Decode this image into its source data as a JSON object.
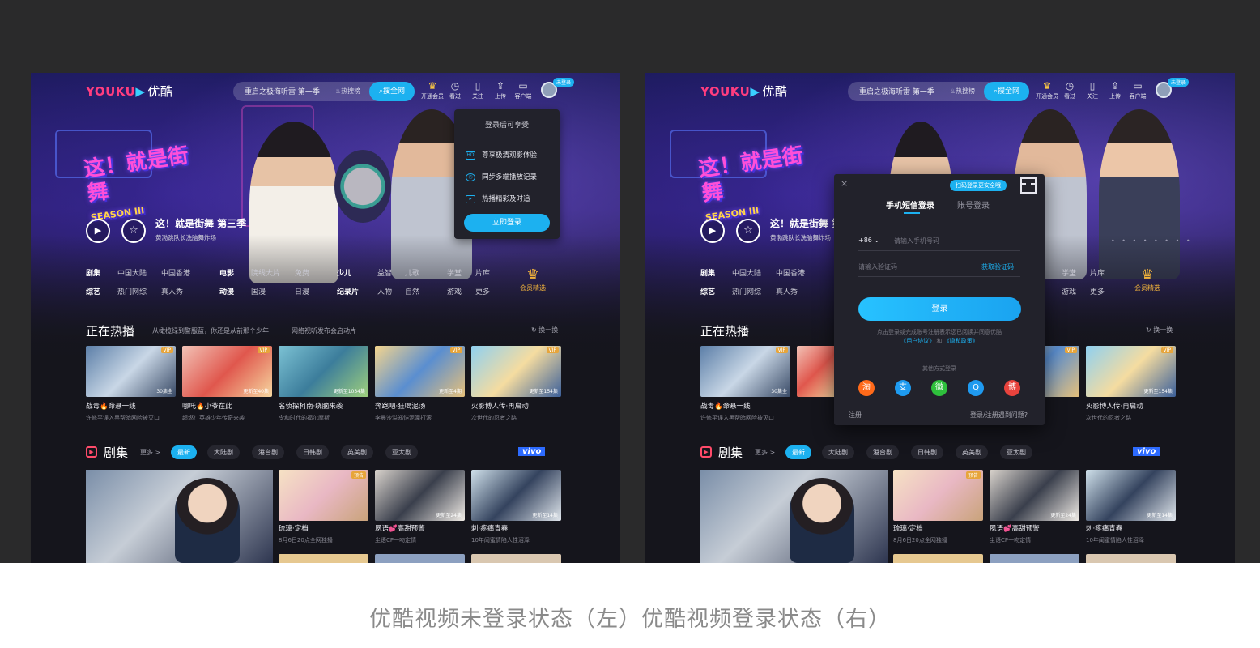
{
  "caption": "优酷视频未登录状态（左）优酷视频登录状态（右）",
  "colors": {
    "accent": "#1cb1f0",
    "brand": "#ff3d7f",
    "vip": "#f2b33c",
    "background": "#15151c"
  },
  "header": {
    "logo_text": "YOUKU",
    "logo_cn": "优酷",
    "search_query": "重启之极海听雷 第一季",
    "hot_label": "热搜榜",
    "search_button": "搜全网",
    "nav": [
      {
        "label": "开通会员",
        "icon": "crown-icon"
      },
      {
        "label": "看过",
        "icon": "clock-icon"
      },
      {
        "label": "关注",
        "icon": "bookmark-icon"
      },
      {
        "label": "上传",
        "icon": "upload-icon"
      },
      {
        "label": "客户端",
        "icon": "monitor-icon"
      }
    ],
    "login_badge": "未登录"
  },
  "hero": {
    "title": "这！就是街舞 第三季",
    "subtitle": "黄渤跳队长洗脑舞炸场",
    "show_logo_sub": "SEASON III"
  },
  "categories": {
    "row1": [
      "剧集",
      "中国大陆",
      "中国香港",
      "电影",
      "院线大片",
      "免费",
      "少儿",
      "益智",
      "儿歌",
      "学堂",
      "片库"
    ],
    "row2": [
      "综艺",
      "热门网综",
      "真人秀",
      "动漫",
      "国漫",
      "日漫",
      "纪录片",
      "人物",
      "自然",
      "游戏",
      "更多"
    ],
    "vip_label": "会员精选"
  },
  "hot_section": {
    "title": "正在热播",
    "note1": "从橄榄绿到警服蓝，你还是从前那个少年",
    "note2": "网络视听发布会启动片",
    "refresh": "换一换",
    "items": [
      {
        "title": "战毒🔥命悬一线",
        "sub": "许修平误入黑帮暗网险被灭口",
        "badge": "VIP",
        "ep": "30集全"
      },
      {
        "title": "哪吒🔥小爷在此",
        "sub": "超燃！英雄少年传奇来袭",
        "badge": "VIP",
        "ep": "更新至40集"
      },
      {
        "title": "名侦探柯南·绕脑来袭",
        "sub": "令和时代的福尔摩斯",
        "badge": "",
        "ep": "更新至1034集"
      },
      {
        "title": "奔跑吧·狂喝泥汤",
        "sub": "李晨沙溢郑恺泥潭打滚",
        "badge": "VIP",
        "ep": "更新至4期"
      },
      {
        "title": "火影博人传·再启动",
        "sub": "次世代的忍者之路",
        "badge": "VIP",
        "ep": "更新至154集"
      }
    ]
  },
  "drama_section": {
    "title": "剧集",
    "more": "更多 >",
    "tabs": [
      "最新",
      "大陆剧",
      "港台剧",
      "日韩剧",
      "英美剧",
      "亚太剧"
    ],
    "sponsor": "vivo",
    "items": [
      {
        "title": "琉璃·定档",
        "sub": "8月6日20点全网独播",
        "badge": "预告"
      },
      {
        "title": "夙语💕高甜预警",
        "sub": "尘语CP一吻定情",
        "badge": "",
        "ep": "更新至24集"
      },
      {
        "title": "刺·疼痛青春",
        "sub": "10年闺蜜情陷人性沼泽",
        "badge": "",
        "ep": "更新至14集"
      }
    ]
  },
  "login_dropdown": {
    "header": "登录后可享受",
    "items": [
      {
        "label": "尊享极清观影体验",
        "icon": "hd-icon"
      },
      {
        "label": "同步多端播放记录",
        "icon": "history-icon"
      },
      {
        "label": "热播精彩及时追",
        "icon": "play-square-icon"
      }
    ],
    "button": "立即登录"
  },
  "login_modal": {
    "close": "×",
    "qr_tag": "扫码登录更安全哦",
    "tab_sms": "手机短信登录",
    "tab_account": "账号登录",
    "country_code": "+86",
    "phone_placeholder": "请输入手机号码",
    "sms_placeholder": "请输入验证码",
    "get_code": "获取验证码",
    "login_button": "登录",
    "terms_text": "点击登录或完成账号注册表示您已阅读并同意优酷",
    "terms_user": "《用户协议》",
    "terms_and": "和",
    "terms_privacy": "《隐私政策》",
    "other_login": "其他方式登录",
    "social": [
      {
        "name": "taobao-icon",
        "glyph": "淘",
        "color": "#ff6a1a"
      },
      {
        "name": "alipay-icon",
        "glyph": "支",
        "color": "#1e9bf0"
      },
      {
        "name": "wechat-icon",
        "glyph": "微",
        "color": "#2ec03c"
      },
      {
        "name": "qq-icon",
        "glyph": "Q",
        "color": "#1f9af0"
      },
      {
        "name": "weibo-icon",
        "glyph": "博",
        "color": "#e8433d"
      }
    ],
    "register": "注册",
    "help": "登录/注册遇到问题?"
  }
}
